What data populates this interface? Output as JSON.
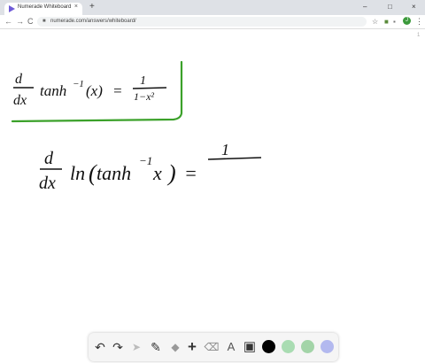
{
  "browser": {
    "tab_title": "Numerade Whiteboard",
    "tab_close": "×",
    "new_tab": "+",
    "win_min": "–",
    "win_max": "□",
    "win_close": "×",
    "back": "←",
    "forward": "→",
    "reload": "C",
    "url": "numerade.com/answers/whiteboard/",
    "page_indicator": "1",
    "avatar_initial": "J"
  },
  "whiteboard": {
    "ink_color": "#111111",
    "box_color": "#3ba12a",
    "line1": {
      "d": "d",
      "dx": "dx",
      "func": "tanh",
      "sup": "−1",
      "arg": "(x)",
      "eq": "=",
      "num": "1",
      "den": "1−x²"
    },
    "line2": {
      "d": "d",
      "dx": "dx",
      "ln": "ln",
      "open": "(",
      "func": "tanh",
      "sup": "−1",
      "x": "x",
      "close": ")",
      "eq": "=",
      "num": "1"
    }
  },
  "dock": {
    "undo": "↶",
    "redo": "↷",
    "pointer": "➤",
    "pen": "✎",
    "shapes": "◆",
    "add": "+",
    "eraser": "⌫",
    "text": "A",
    "image": "▣",
    "colors": [
      "#000000",
      "#a9dcb2",
      "#a3d4a8",
      "#b3b9ef"
    ]
  }
}
